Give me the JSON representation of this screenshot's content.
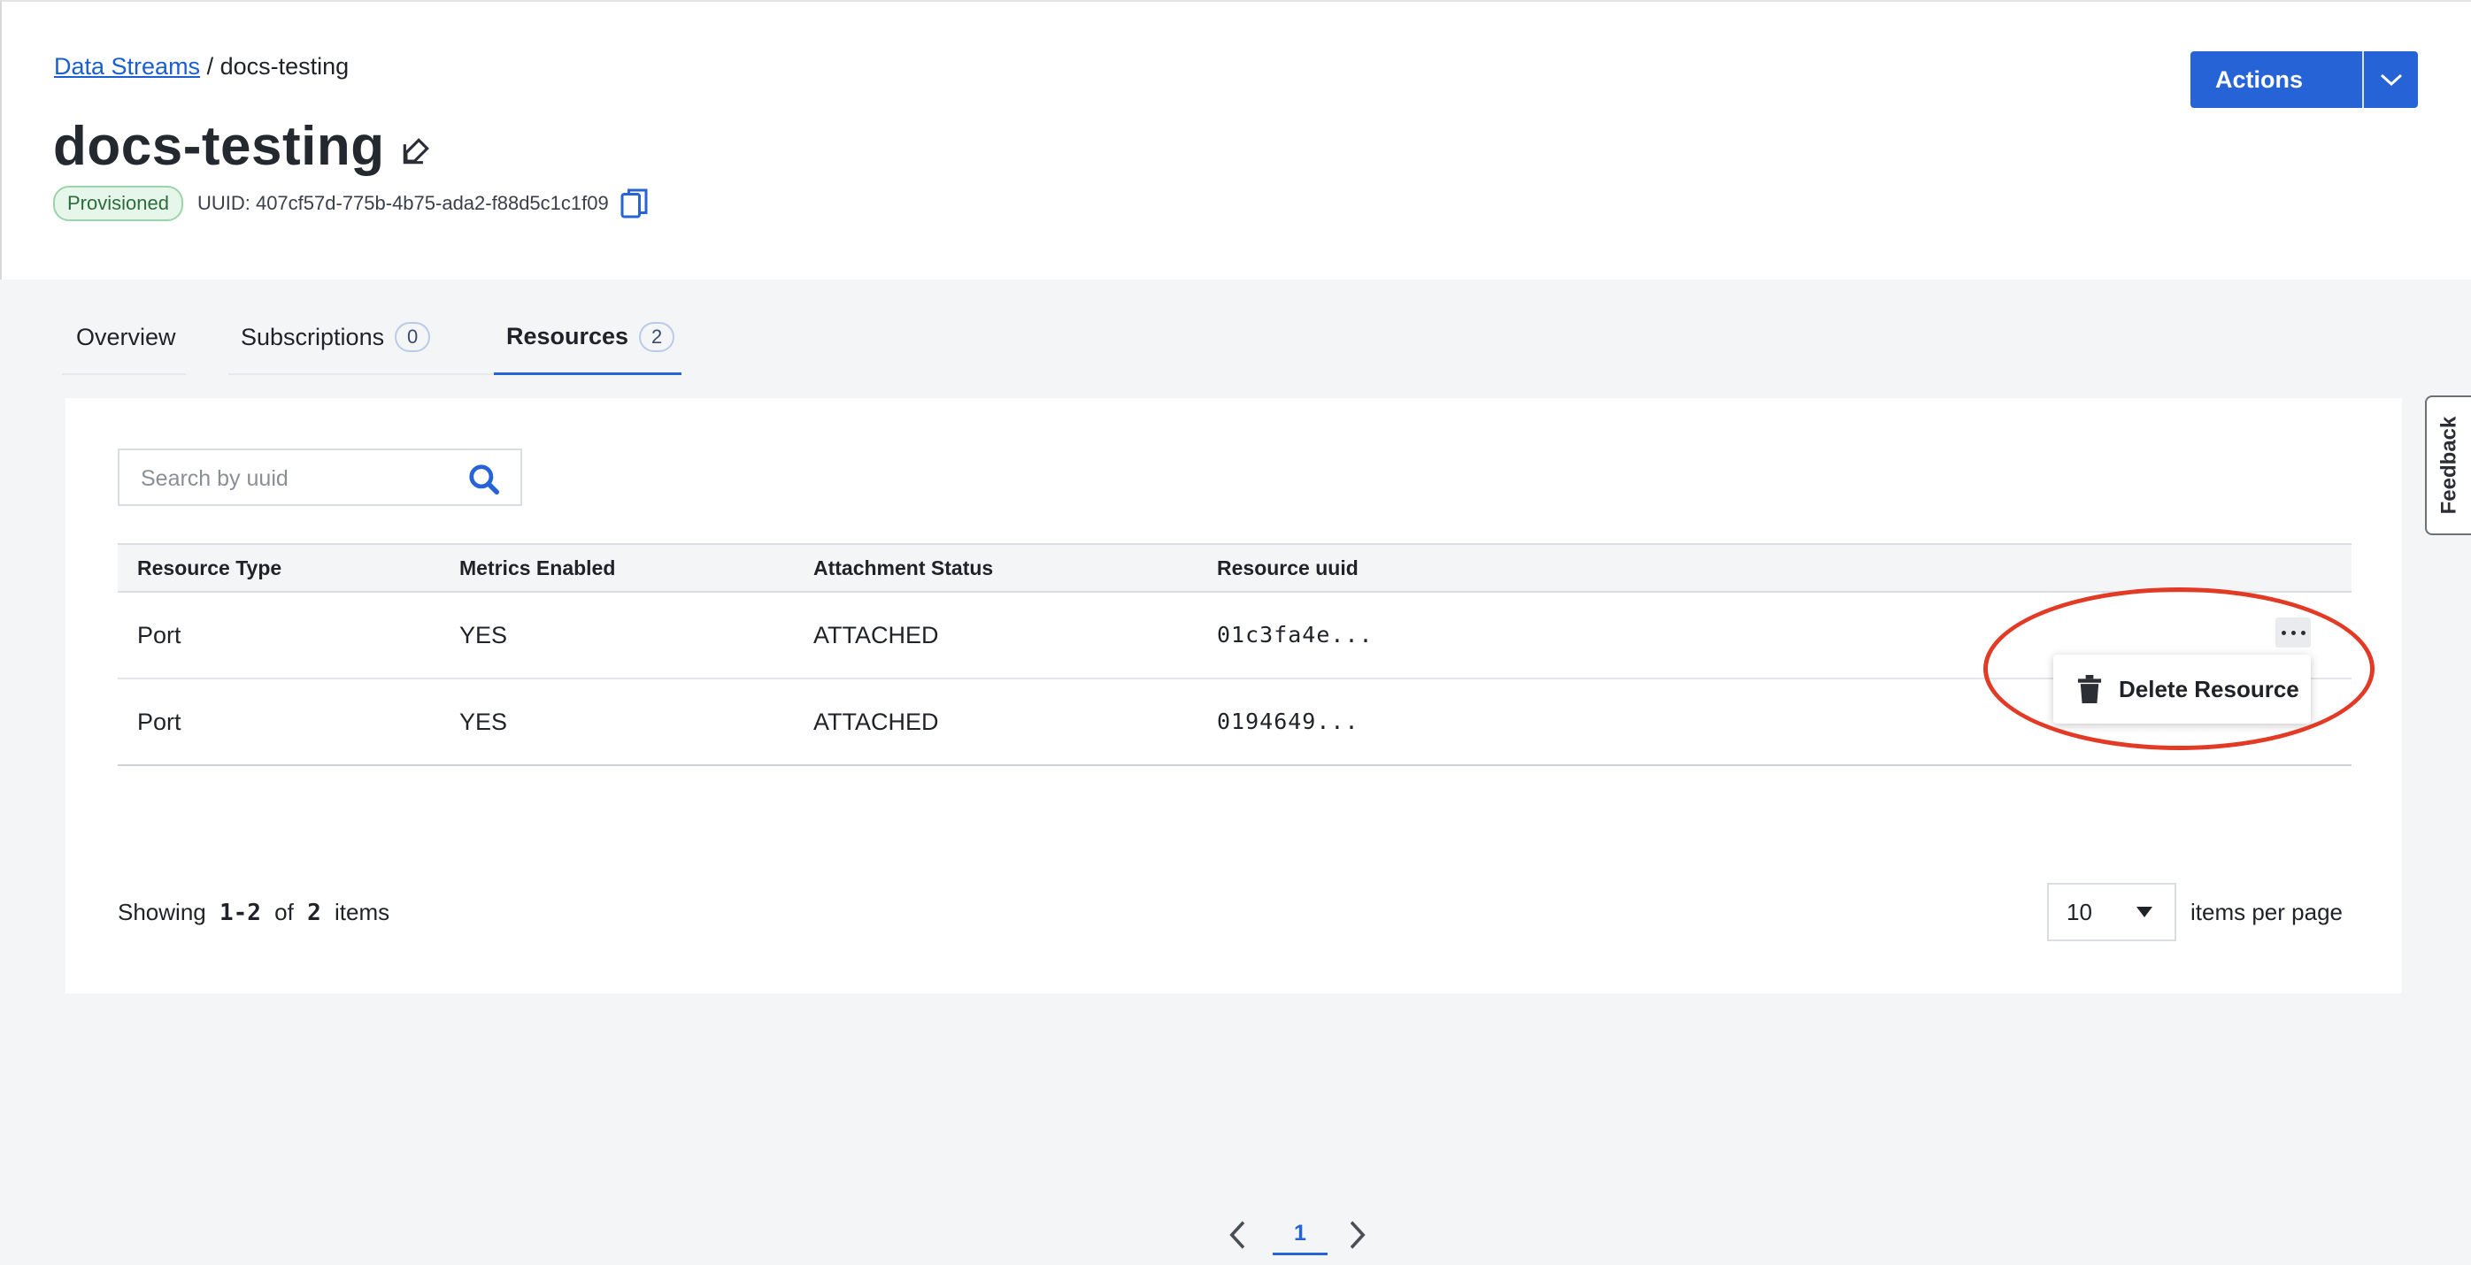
{
  "breadcrumb": {
    "parent": "Data Streams",
    "separator": "/",
    "current": "docs-testing"
  },
  "header": {
    "title": "docs-testing",
    "status": "Provisioned",
    "uuid_label": "UUID: 407cf57d-775b-4b75-ada2-f88d5c1c1f09",
    "actions_label": "Actions"
  },
  "tabs": [
    {
      "label": "Overview",
      "count": null,
      "active": false
    },
    {
      "label": "Subscriptions",
      "count": "0",
      "active": false
    },
    {
      "label": "Resources",
      "count": "2",
      "active": true
    }
  ],
  "search": {
    "placeholder": "Search by uuid"
  },
  "table": {
    "columns": [
      "Resource Type",
      "Metrics Enabled",
      "Attachment Status",
      "Resource uuid"
    ],
    "rows": [
      [
        "Port",
        "YES",
        "ATTACHED",
        "01c3fa4e..."
      ],
      [
        "Port",
        "YES",
        "ATTACHED",
        "0194649..."
      ]
    ]
  },
  "row_menu": {
    "delete_label": "Delete Resource"
  },
  "pagination": {
    "current_page": "1"
  },
  "footer": {
    "showing_prefix": "Showing",
    "range": "1-2",
    "of": "of",
    "total": "2",
    "items": "items",
    "page_size": "10",
    "per_page_label": "items per page"
  },
  "feedback": {
    "label": "Feedback"
  },
  "colors": {
    "accent": "#2563d6",
    "highlight": "#e23a25",
    "status_bg": "#e6f6ea"
  },
  "icons": [
    "edit-icon",
    "copy-icon",
    "chevron-down-icon",
    "search-icon",
    "kebab-icon",
    "trash-icon",
    "chevron-left-icon",
    "chevron-right-icon",
    "caret-down-icon"
  ]
}
